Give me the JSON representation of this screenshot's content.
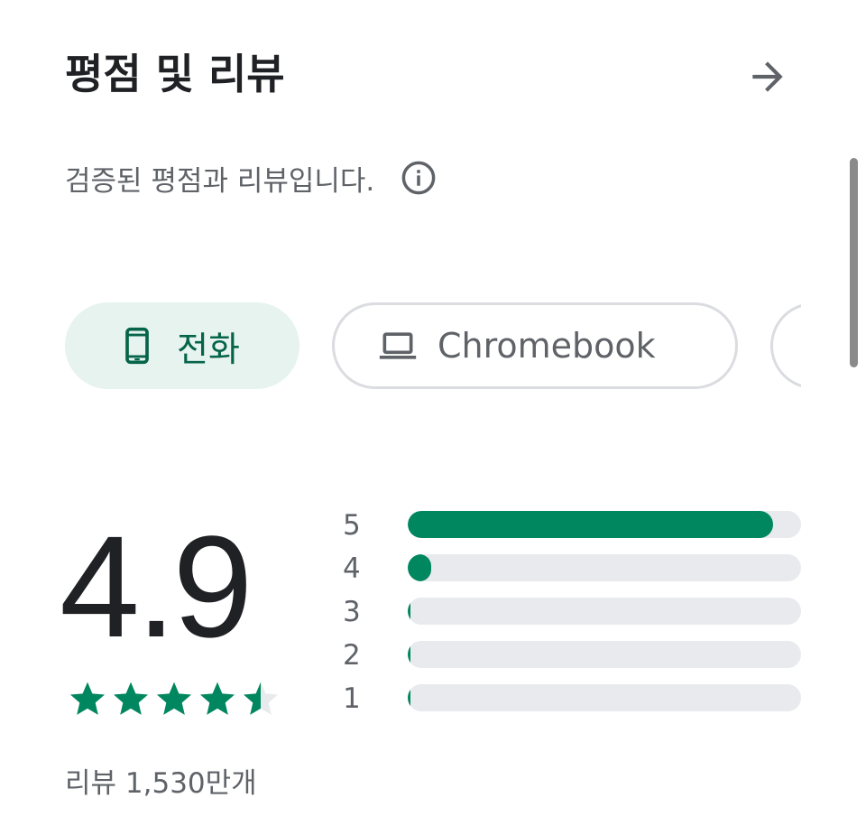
{
  "header": {
    "title": "평점 및 리뷰"
  },
  "subtitle": {
    "text": "검증된 평점과 리뷰입니다."
  },
  "chips": [
    {
      "label": "전화",
      "icon": "phone-icon",
      "selected": true
    },
    {
      "label": "Chromebook",
      "icon": "laptop-icon",
      "selected": false
    }
  ],
  "rating": {
    "score": "4.9",
    "stars_filled": 4.5,
    "review_count": "리뷰 1,530만개"
  },
  "distribution": [
    {
      "label": "5",
      "fraction": 0.93
    },
    {
      "label": "4",
      "fraction": 0.06
    },
    {
      "label": "3",
      "fraction": 0.005
    },
    {
      "label": "2",
      "fraction": 0.004
    },
    {
      "label": "1",
      "fraction": 0.005
    }
  ],
  "colors": {
    "accent": "#01875f",
    "chip_selected_bg": "#e6f3ee",
    "chip_selected_text": "#056449",
    "track": "#e8eaed"
  }
}
